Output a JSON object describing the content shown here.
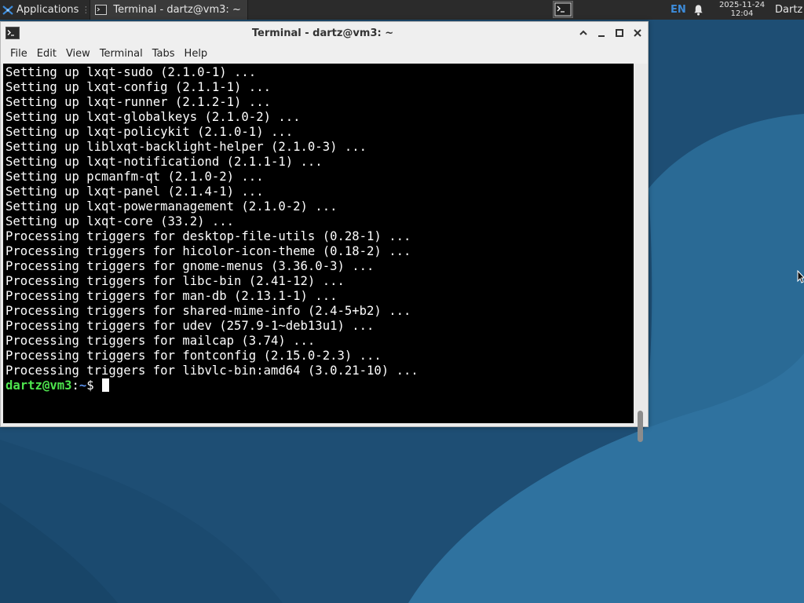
{
  "panel": {
    "apps_label": "Applications",
    "task_title": "Terminal - dartz@vm3: ~",
    "lang": "EN",
    "date": "2025-11-24",
    "time": "12:04",
    "user": "Dartz"
  },
  "window": {
    "title": "Terminal - dartz@vm3: ~",
    "menu": [
      "File",
      "Edit",
      "View",
      "Terminal",
      "Tabs",
      "Help"
    ]
  },
  "terminal": {
    "lines": [
      "Setting up lxqt-sudo (2.1.0-1) ...",
      "Setting up lxqt-config (2.1.1-1) ...",
      "Setting up lxqt-runner (2.1.2-1) ...",
      "Setting up lxqt-globalkeys (2.1.0-2) ...",
      "Setting up lxqt-policykit (2.1.0-1) ...",
      "Setting up liblxqt-backlight-helper (2.1.0-3) ...",
      "Setting up lxqt-notificationd (2.1.1-1) ...",
      "Setting up pcmanfm-qt (2.1.0-2) ...",
      "Setting up lxqt-panel (2.1.4-1) ...",
      "Setting up lxqt-powermanagement (2.1.0-2) ...",
      "Setting up lxqt-core (33.2) ...",
      "Processing triggers for desktop-file-utils (0.28-1) ...",
      "Processing triggers for hicolor-icon-theme (0.18-2) ...",
      "Processing triggers for gnome-menus (3.36.0-3) ...",
      "Processing triggers for libc-bin (2.41-12) ...",
      "Processing triggers for man-db (2.13.1-1) ...",
      "Processing triggers for shared-mime-info (2.4-5+b2) ...",
      "Processing triggers for udev (257.9-1~deb13u1) ...",
      "Processing triggers for mailcap (3.74) ...",
      "Processing triggers for fontconfig (2.15.0-2.3) ...",
      "Processing triggers for libvlc-bin:amd64 (3.0.21-10) ..."
    ],
    "prompt_user": "dartz@vm3",
    "prompt_colon": ":",
    "prompt_path": "~",
    "prompt_symbol": "$ "
  },
  "colors": {
    "prompt_user": "#4ee44e",
    "prompt_path": "#5a8ee8",
    "terminal_bg": "#000000",
    "panel_bg": "#2b2b2b",
    "lang_accent": "#3d8bd9"
  },
  "icons": {
    "apps": "lxqt-logo-icon",
    "task": "terminal-icon",
    "quicklaunch": "terminal-icon",
    "tray": "bell-icon",
    "window": "terminal-icon"
  }
}
